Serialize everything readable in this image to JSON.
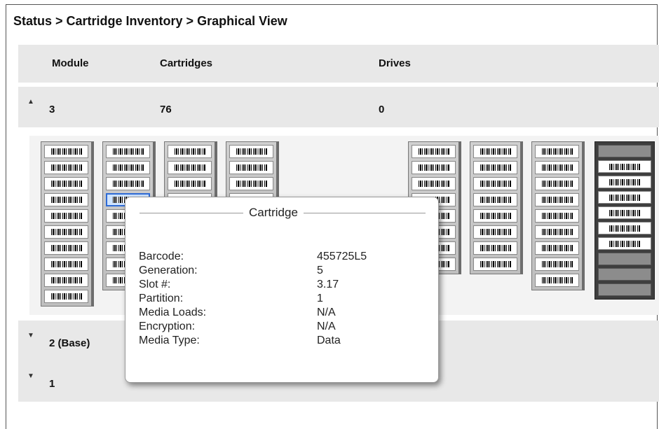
{
  "breadcrumb": "Status > Cartridge Inventory > Graphical View",
  "table": {
    "headers": {
      "module": "Module",
      "cartridges": "Cartridges",
      "drives": "Drives"
    },
    "rows": [
      {
        "module": "3",
        "cartridges": "76",
        "drives": "0",
        "expanded": true,
        "arrow_icon": "triangle-up"
      },
      {
        "module": "2 (Base)",
        "cartridges": "",
        "drives": "",
        "expanded": false,
        "arrow_icon": "triangle-down"
      },
      {
        "module": "1",
        "cartridges": "",
        "drives": "",
        "expanded": false,
        "arrow_icon": "triangle-down"
      }
    ]
  },
  "popup": {
    "title": "Cartridge",
    "fields": [
      {
        "label": "Barcode:",
        "value": "455725L5"
      },
      {
        "label": "Generation:",
        "value": "5"
      },
      {
        "label": "Slot #:",
        "value": "3.17"
      },
      {
        "label": "Partition:",
        "value": "1"
      },
      {
        "label": "Media Loads:",
        "value": "N/A"
      },
      {
        "label": "Encryption:",
        "value": "N/A"
      },
      {
        "label": "Media Type:",
        "value": "Data"
      }
    ]
  },
  "colors": {
    "row_bg": "#e8e8e8",
    "selected_slot": "#2e6bd6"
  }
}
